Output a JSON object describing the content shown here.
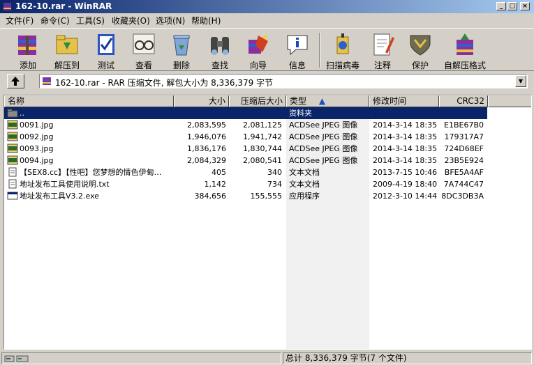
{
  "window": {
    "title": "162-10.rar - WinRAR",
    "controls": [
      "_",
      "□",
      "×"
    ]
  },
  "menu": [
    "文件(F)",
    "命令(C)",
    "工具(S)",
    "收藏夹(O)",
    "选项(N)",
    "帮助(H)"
  ],
  "toolbar": [
    {
      "label": "添加",
      "icon": "add-archive-icon"
    },
    {
      "label": "解压到",
      "icon": "extract-folder-icon"
    },
    {
      "label": "测试",
      "icon": "test-check-icon"
    },
    {
      "label": "查看",
      "icon": "view-glasses-icon"
    },
    {
      "label": "删除",
      "icon": "delete-recycle-icon"
    },
    {
      "label": "查找",
      "icon": "find-binoculars-icon"
    },
    {
      "label": "向导",
      "icon": "wizard-icon"
    },
    {
      "label": "信息",
      "icon": "info-icon"
    },
    {
      "label": "扫描病毒",
      "icon": "virus-scan-icon"
    },
    {
      "label": "注释",
      "icon": "comment-icon"
    },
    {
      "label": "保护",
      "icon": "protect-shield-icon"
    },
    {
      "label": "自解压格式",
      "icon": "sfx-icon"
    }
  ],
  "address": {
    "text": "162-10.rar - RAR 压缩文件, 解包大小为 8,336,379 字节"
  },
  "columns": [
    "名称",
    "大小",
    "压缩后大小",
    "类型",
    "修改时间",
    "CRC32"
  ],
  "files": [
    {
      "name": "..",
      "size": "",
      "packed": "",
      "type": "资料夹",
      "modified": "",
      "crc": "",
      "icon": "folder",
      "selected": true
    },
    {
      "name": "0091.jpg",
      "size": "2,083,595",
      "packed": "2,081,125",
      "type": "ACDSee JPEG 图像",
      "modified": "2014-3-14 18:35",
      "crc": "E1BE67B0",
      "icon": "jpeg"
    },
    {
      "name": "0092.jpg",
      "size": "1,946,076",
      "packed": "1,941,742",
      "type": "ACDSee JPEG 图像",
      "modified": "2014-3-14 18:35",
      "crc": "179317A7",
      "icon": "jpeg"
    },
    {
      "name": "0093.jpg",
      "size": "1,836,176",
      "packed": "1,830,744",
      "type": "ACDSee JPEG 图像",
      "modified": "2014-3-14 18:35",
      "crc": "724D68EF",
      "icon": "jpeg"
    },
    {
      "name": "0094.jpg",
      "size": "2,084,329",
      "packed": "2,080,541",
      "type": "ACDSee JPEG 图像",
      "modified": "2014-3-14 18:35",
      "crc": "23B5E924",
      "icon": "jpeg"
    },
    {
      "name": "【SEX8.cc】【性吧】您梦想的情色伊甸…",
      "size": "405",
      "packed": "340",
      "type": "文本文档",
      "modified": "2013-7-15 10:46",
      "crc": "BFE5A4AF",
      "icon": "text"
    },
    {
      "name": "地址发布工具使用说明.txt",
      "size": "1,142",
      "packed": "734",
      "type": "文本文档",
      "modified": "2009-4-19 18:40",
      "crc": "7A744C47",
      "icon": "text"
    },
    {
      "name": "地址发布工具V3.2.exe",
      "size": "384,656",
      "packed": "155,555",
      "type": "应用程序",
      "modified": "2012-3-10 14:44",
      "crc": "8DC3DB3A",
      "icon": "exe"
    }
  ],
  "status": {
    "total": "总计 8,336,379 字节(7 个文件)"
  }
}
